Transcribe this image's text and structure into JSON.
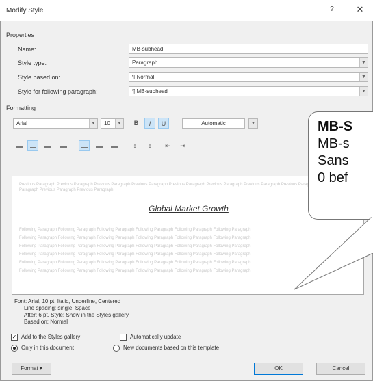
{
  "dialog": {
    "title": "Modify Style",
    "help": "?",
    "close": "✕"
  },
  "properties": {
    "section": "Properties",
    "name_label": "Name:",
    "name_value": "MB-subhead",
    "type_label": "Style type:",
    "type_value": "Paragraph",
    "based_label": "Style based on:",
    "based_value": "¶ Normal",
    "following_label": "Style for following paragraph:",
    "following_value": "¶ MB-subhead"
  },
  "formatting": {
    "section": "Formatting",
    "font": "Arial",
    "size": "10",
    "bold": "B",
    "italic": "I",
    "underline": "U",
    "color": "Automatic"
  },
  "preview": {
    "previous_text": "Previous Paragraph Previous Paragraph Previous Paragraph Previous Paragraph Previous Paragraph Previous Paragraph Previous Paragraph Previous Paragraph Previous Paragraph Previous Paragraph Previous Paragraph",
    "sample_text": "Global Market Growth",
    "following_line": "Following Paragraph Following Paragraph Following Paragraph Following Paragraph Following Paragraph Following Paragraph"
  },
  "description": {
    "line1": "Font: Arial, 10 pt, Italic, Underline, Centered",
    "line2": "Line spacing:  single, Space",
    "line3": "After:  6 pt, Style: Show in the Styles gallery",
    "line4": "Based on: Normal"
  },
  "options": {
    "add_gallery": "Add to the Styles gallery",
    "auto_update": "Automatically update",
    "only_doc": "Only in this document",
    "new_docs": "New documents based on this template"
  },
  "buttons": {
    "format": "Format ▾",
    "ok": "OK",
    "cancel": "Cancel"
  },
  "callout": {
    "title": "MB-S",
    "line1": "MB-s",
    "line2": "Sans",
    "line3": "0 bef"
  }
}
